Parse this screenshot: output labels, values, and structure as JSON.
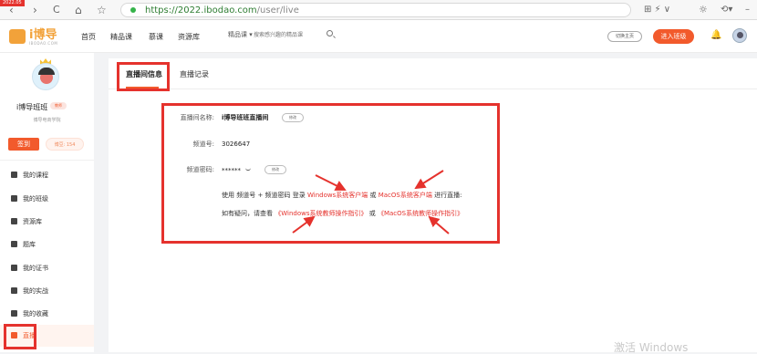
{
  "browser": {
    "corner_tag": "2022.05",
    "url_host": "https://2022.ibodao.com",
    "url_path": "/user/live",
    "nav_back": "‹",
    "nav_forward": "›",
    "nav_reload": "C",
    "nav_home": "⌂",
    "nav_star": "☆",
    "right_tools": "⊞ ⚡ ∨",
    "settings": "☼",
    "undo": "⟲▾",
    "minimize": "–"
  },
  "header": {
    "logo_text": "i博导",
    "logo_sub": "IBODAO.COM",
    "nav": [
      "首页",
      "精品课",
      "慕课",
      "资源库"
    ],
    "category_select": "精品课 ▾",
    "search_placeholder": "搜索感兴趣的精品课",
    "switch_button": "切换主页",
    "enter_button": "进入班级",
    "bell": "🔔"
  },
  "sidebar": {
    "name": "i博导班班",
    "vip_badge": "教师",
    "school": "博导电商学院",
    "checkin_button": "签到",
    "points": "博豆: 154",
    "items": [
      {
        "label": "我的课程"
      },
      {
        "label": "我的班级"
      },
      {
        "label": "资源库"
      },
      {
        "label": "题库"
      },
      {
        "label": "我的证书"
      },
      {
        "label": "我的实战"
      },
      {
        "label": "我的收藏"
      },
      {
        "label": "直播"
      }
    ]
  },
  "main": {
    "tabs": [
      {
        "label": "直播间信息"
      },
      {
        "label": "直播记录"
      }
    ],
    "room_name_label": "直播间名称:",
    "room_name_value": "i博导班班直播间",
    "edit_label": "修改",
    "channel_no_label": "频道号:",
    "channel_no_value": "3026647",
    "channel_pwd_label": "频道密码:",
    "channel_pwd_value": "******",
    "guide_1_prefix": "使用 频道号 + 频道密码 登录",
    "guide_1_win": "Windows系统客户端",
    "guide_1_or": "或",
    "guide_1_mac": "MacOS系统客户端",
    "guide_1_suffix": "进行直播:",
    "guide_2_prefix": "如有疑问，请查看",
    "guide_2_win": "《Windows系统教师操作指引》",
    "guide_2_or": "或",
    "guide_2_mac": "《MacOS系统教师操作指引》"
  },
  "watermark": "激活 Windows",
  "colors": {
    "accent": "#f25a2c",
    "annotation": "#e5322d",
    "link": "#e5322d"
  }
}
